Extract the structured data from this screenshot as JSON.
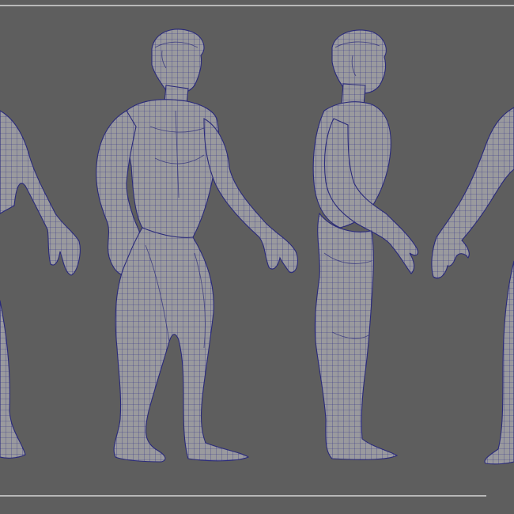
{
  "scene": {
    "colors": {
      "background": "#5e5e5e",
      "rule_line": "#b9b9b9",
      "mesh_fill": "#9a9a9e",
      "wire": "#2e2e86"
    },
    "views": [
      "back-left-partial",
      "three-quarter-front",
      "side-profile",
      "back-right-partial"
    ]
  }
}
